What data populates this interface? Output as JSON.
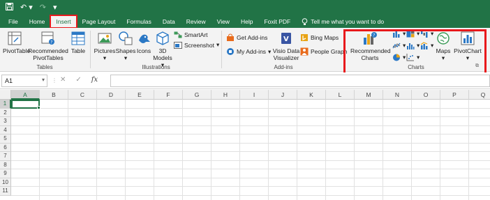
{
  "quick_access": {
    "save_icon": "save-icon",
    "undo_icon": "undo-icon",
    "redo_icon": "redo-icon",
    "customize_icon": "customize-qat-icon"
  },
  "menu": {
    "tabs": [
      "File",
      "Home",
      "Insert",
      "Page Layout",
      "Formulas",
      "Data",
      "Review",
      "View",
      "Help",
      "Foxit PDF"
    ],
    "active_tab": "Insert",
    "tell_me": "Tell me what you want to do"
  },
  "ribbon": {
    "tables": {
      "label": "Tables",
      "pivot_table": "PivotTable",
      "recommended_pivot_1": "Recommended",
      "recommended_pivot_2": "PivotTables",
      "table": "Table"
    },
    "illustrations": {
      "label": "Illustrations",
      "pictures": "Pictures",
      "shapes": "Shapes",
      "icons": "Icons",
      "models_1": "3D",
      "models_2": "Models",
      "smartart": "SmartArt",
      "screenshot": "Screenshot"
    },
    "addins": {
      "label": "Add-ins",
      "get_addins": "Get Add-ins",
      "my_addins": "My Add-ins",
      "visio_1": "Visio Data",
      "visio_2": "Visualizer",
      "bing_maps": "Bing Maps",
      "people_graph": "People Graph"
    },
    "charts": {
      "label": "Charts",
      "recommended_1": "Recommended",
      "recommended_2": "Charts",
      "maps": "Maps",
      "pivot_chart": "PivotChart"
    }
  },
  "formula_bar": {
    "name_box": "A1",
    "cancel": "✕",
    "enter": "✓",
    "fx": "fx",
    "value": ""
  },
  "sheet": {
    "columns": [
      "A",
      "B",
      "C",
      "D",
      "E",
      "F",
      "G",
      "H",
      "I",
      "J",
      "K",
      "L",
      "M",
      "N",
      "O",
      "P",
      "Q"
    ],
    "rows": [
      "1",
      "2",
      "3",
      "4",
      "5",
      "6",
      "7",
      "8",
      "9",
      "10",
      "11"
    ],
    "selected_cell": "A1"
  },
  "colors": {
    "excel_green": "#217346",
    "highlight_red": "#e8191c"
  }
}
